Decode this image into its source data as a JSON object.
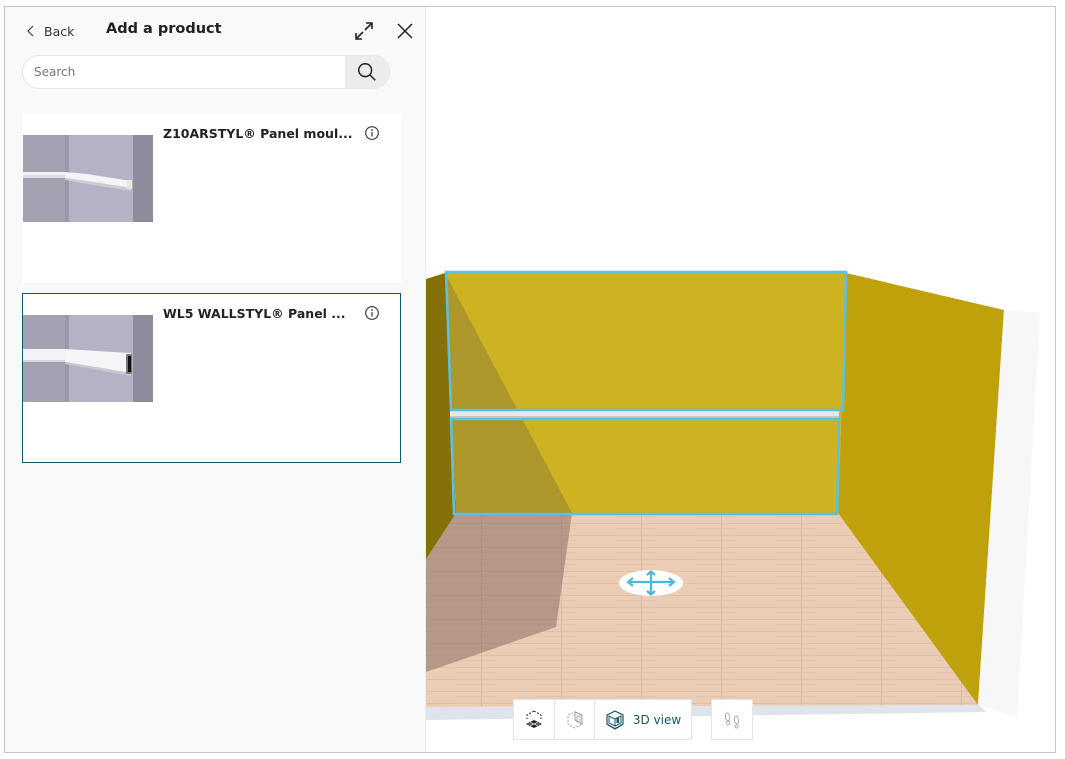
{
  "panel": {
    "back_label": "Back",
    "title": "Add a product",
    "expand_icon": "expand-arrows-icon",
    "close_icon": "close-icon"
  },
  "search": {
    "placeholder": "Search",
    "value": "",
    "icon": "search-icon"
  },
  "products": [
    {
      "name": "Z10ARSTYL® Panel moul...",
      "selected": false,
      "info_icon": "info-icon"
    },
    {
      "name": "WL5 WALLSTYL® Panel ...",
      "selected": true,
      "info_icon": "info-icon"
    }
  ],
  "viewport": {
    "selection_color": "#5bc0e3",
    "wall_color": "#cdb221",
    "side_wall_color": "#bfa20b",
    "floor_color": "#e9c8b0",
    "move_handle_icon": "move-arrows-icon"
  },
  "toolbar": {
    "buttons": [
      {
        "id": "2d-plan",
        "icon": "floor-plan-icon",
        "label": ""
      },
      {
        "id": "wall-view",
        "icon": "wall-elevation-icon",
        "label": ""
      },
      {
        "id": "3d-view",
        "icon": "3d-room-icon",
        "label": "3D view"
      }
    ],
    "walk_button": {
      "id": "walk",
      "icon": "footsteps-icon",
      "label": ""
    }
  }
}
